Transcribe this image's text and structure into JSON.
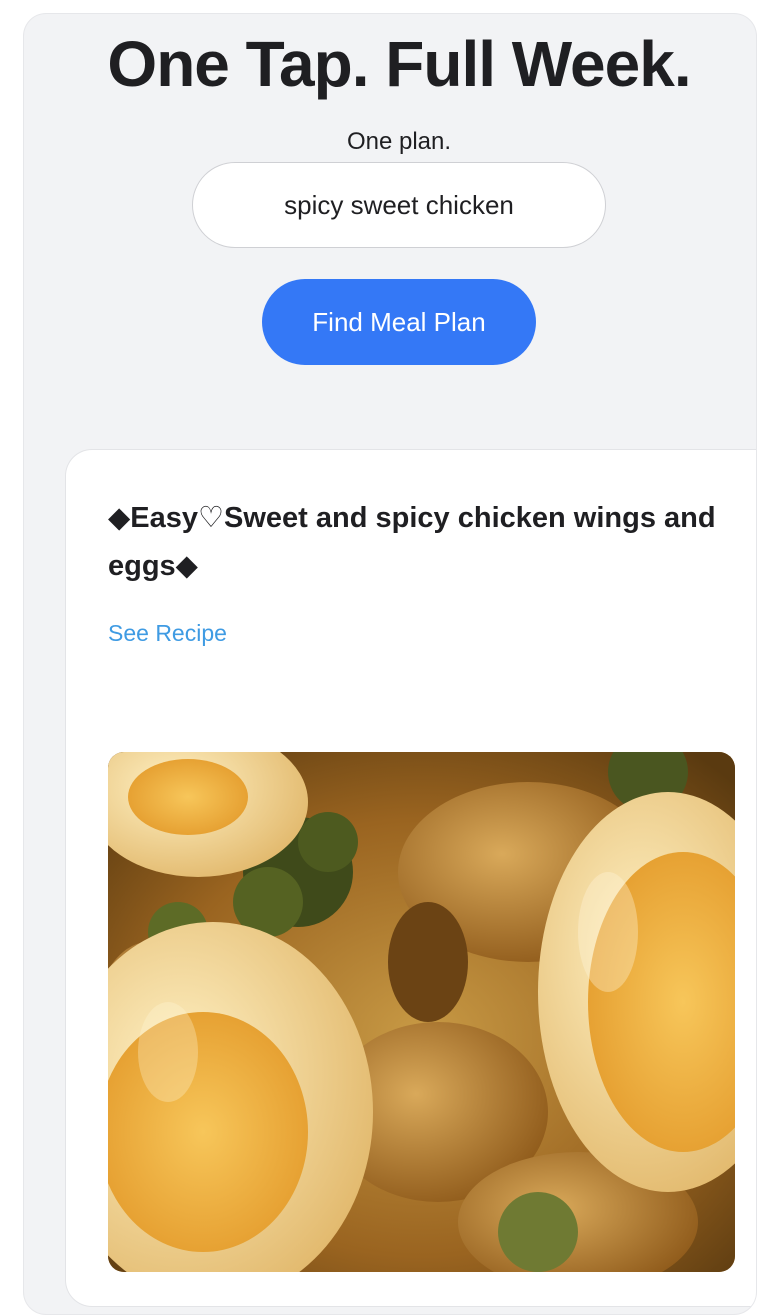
{
  "hero": {
    "headline": "One Tap. Full Week.",
    "subtitle": "One plan."
  },
  "search": {
    "value": "spicy sweet chicken",
    "button_label": "Find Meal Plan"
  },
  "recipe": {
    "title": "◆Easy♡Sweet and spicy chicken wings and eggs◆",
    "link_label": "See Recipe",
    "image_icon": "food-photo"
  },
  "colors": {
    "accent": "#3478f6",
    "link": "#3f9be3",
    "panel_background": "#f2f3f5"
  }
}
